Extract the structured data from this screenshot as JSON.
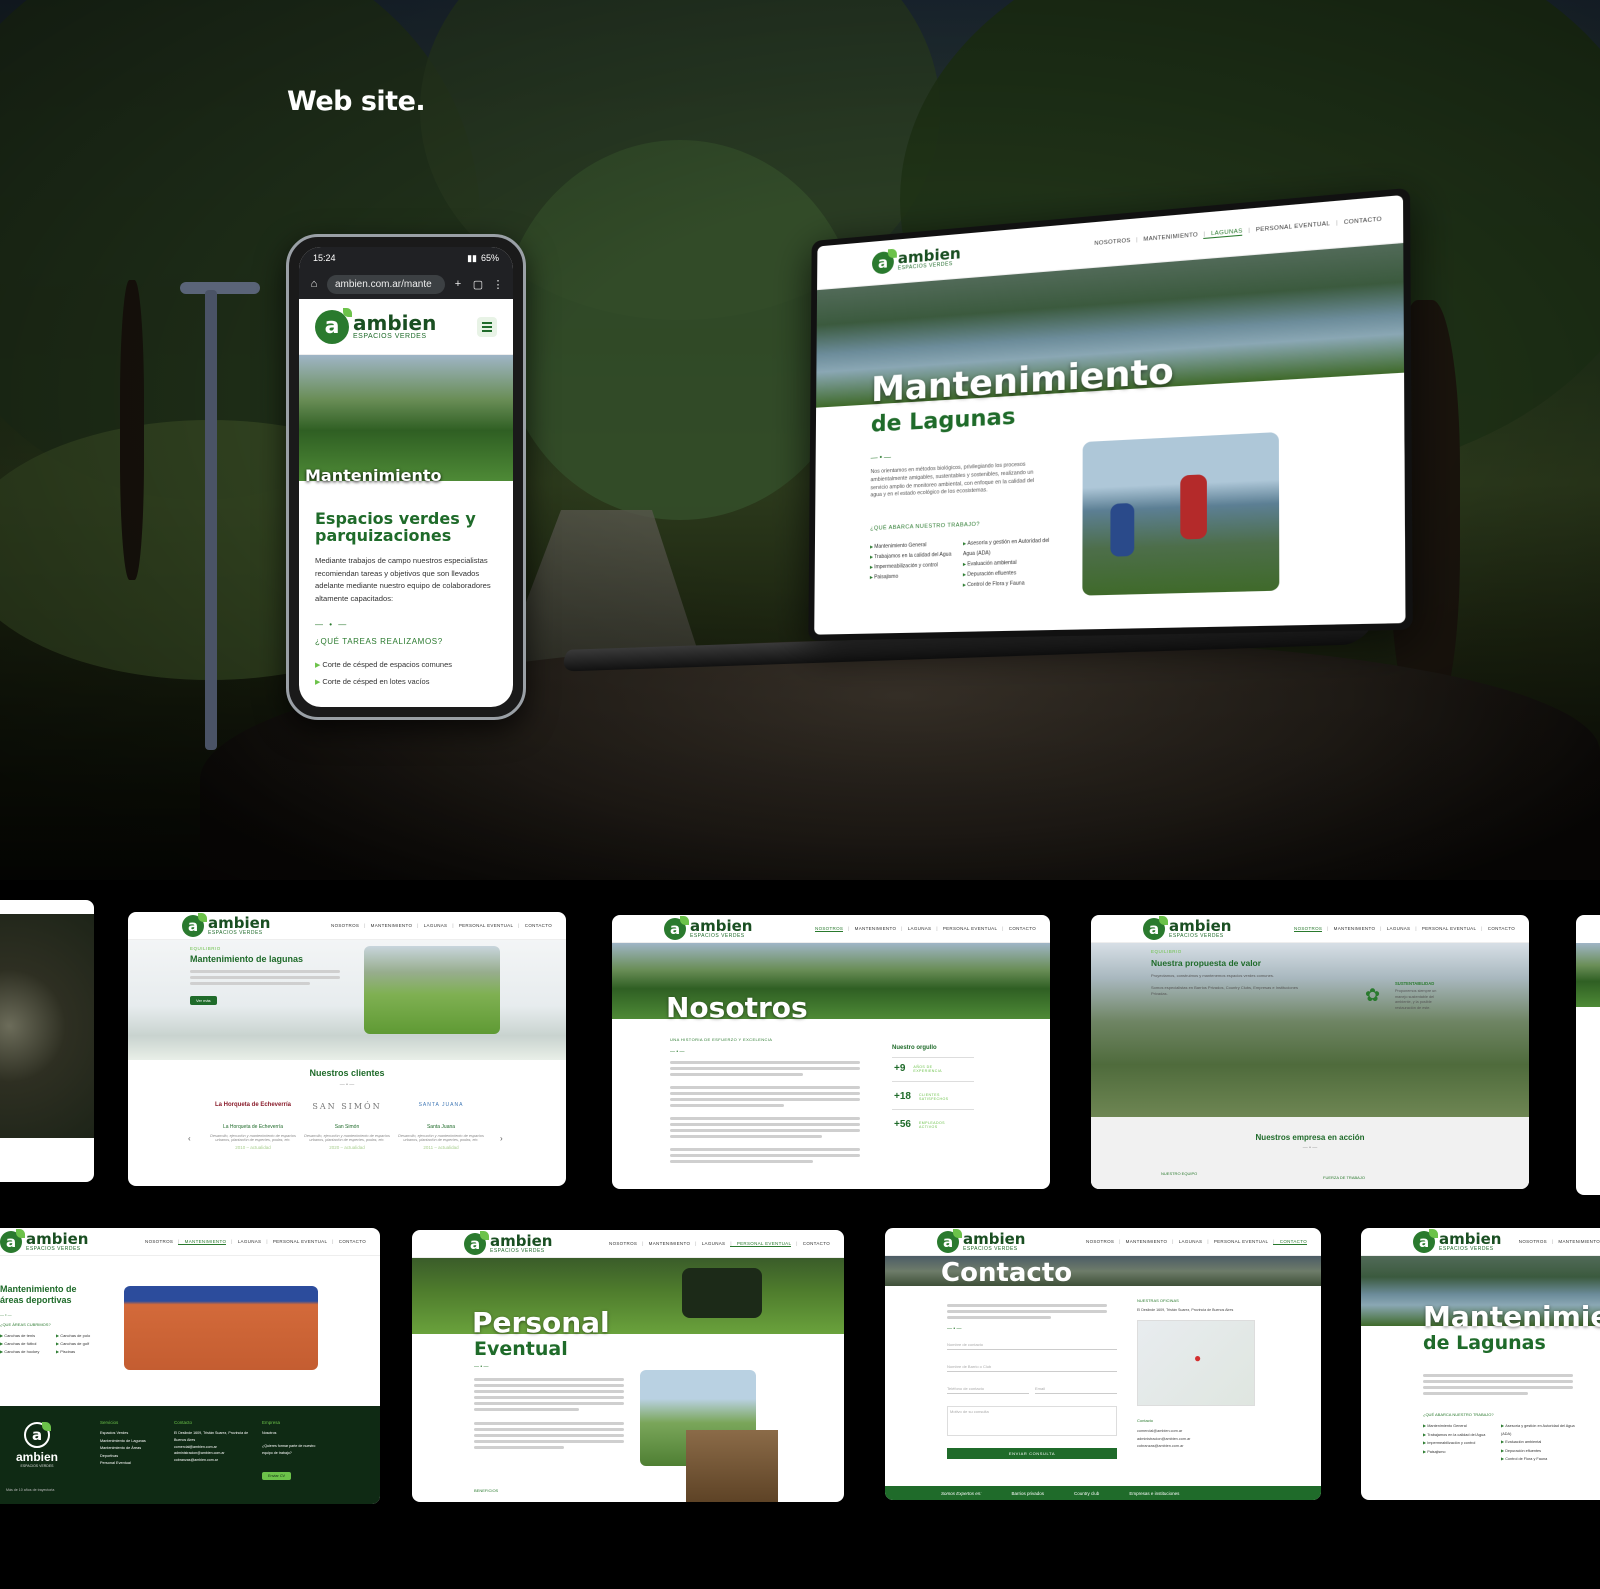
{
  "section_title": "Web site.",
  "brand": {
    "name": "ambien",
    "tagline": "ESPACIOS VERDES",
    "accent": "#1f6b2a",
    "light_accent": "#6cc24a"
  },
  "nav": [
    "NOSOTROS",
    "MANTENIMIENTO",
    "LAGUNAS",
    "PERSONAL EVENTUAL",
    "CONTACTO"
  ],
  "phone": {
    "time": "15:24",
    "battery": "65%",
    "url": "ambien.com.ar/mante",
    "hero_title": "Mantenimiento",
    "heading": "Espacios verdes y parquizaciones",
    "body": "Mediante trabajos de campo nuestros especialistas recomiendan tareas y objetivos que son llevados adelante mediante nuestro equipo de colaboradores altamente capacitados:",
    "dash": "— • —",
    "question": "¿QUÉ TAREAS REALIZAMOS?",
    "items": [
      "Corte de césped de espacios comunes",
      "Corte de césped en lotes vacíos"
    ]
  },
  "laptop": {
    "title_line1": "Mantenimiento",
    "title_line2": "de Lagunas",
    "dash": "— • —",
    "body": "Nos orientamos en métodos biológicos, privilegiando los procesos ambientalmente amigables, sustentables y sostenibles, realizando un servicio amplio de monitoreo ambiental, con enfoque en la calidad del agua y en el estado ecológico de los ecosistemas.",
    "question": "¿QUÉ ABARCA NUESTRO TRABAJO?",
    "list_left": [
      "Mantenimiento General",
      "Trabajamos en la calidad del Agua",
      "Impermeabilización y control",
      "Paisajismo"
    ],
    "list_right": [
      "Asesoría y gestión en Autoridad del Agua (ADA)",
      "Evaluación ambiental",
      "Depuración efluentes",
      "Control de Flora y Fauna"
    ]
  },
  "cards": {
    "lagunas_clientes": {
      "kicker": "EQUILIBRIO",
      "title": "Mantenimiento de lagunas",
      "button": "Ver más",
      "clients_title": "Nuestros clientes",
      "clients": [
        {
          "logo": "La Horqueta de Echeverría",
          "name": "La Horqueta de Echeverría",
          "years": "2010 – actualidad"
        },
        {
          "logo": "SAN SIMÓN",
          "name": "San Simón",
          "years": "2020 – actualidad"
        },
        {
          "logo": "SANTA JUANA",
          "name": "Santa Juana",
          "years": "2011 – actualidad"
        }
      ],
      "client_desc": "Desarrollo, ejecución y mantenimiento de espacios urbanos, plantación de especies, podas, etc."
    },
    "nosotros": {
      "hero": "Nosotros",
      "kicker": "UNA HISTORIA DE ESFUERZO Y EXCELENCIA",
      "pride": "Nuestro orgullo",
      "stats": [
        {
          "value": "+9",
          "label": "AÑOS DE EXPERIENCIA"
        },
        {
          "value": "+18",
          "label": "CLIENTES SATISFECHOS"
        },
        {
          "value": "+56",
          "label": "EMPLEADOS ACTIVOS"
        }
      ]
    },
    "propuesta": {
      "kicker": "EQUILIBRIO",
      "title": "Nuestra propuesta de valor",
      "p1": "Proyectamos, construimos y mantenemos espacios verdes comunes.",
      "p2": "Somos especialistas en Barrios Privados, Country Clubs, Empresas e Instituciones Privadas.",
      "side_title": "SUSTENTABILIDAD",
      "side_text": "Proponemos siempre un manejo sustentable del ambiente, y la posible restauración de este.",
      "action": "Nuestros empresa en acción",
      "team": "NUESTRO EQUIPO",
      "workforce": "FUERZA DE TRABAJO"
    },
    "deportivas": {
      "title": "Mantenimiento de áreas deportivas",
      "question": "¿QUE ÁREAS CUBRIMOS?",
      "list_left": [
        "Canchas de tenis",
        "Canchas de fútbol",
        "Canchas de hockey"
      ],
      "list_right": [
        "Canchas de polo",
        "Canchas de golf",
        "Piscinas"
      ],
      "footer": {
        "tagline": "Más de 10 años de trayectoria",
        "services_title": "Servicios",
        "services": [
          "Espacios Verdes",
          "Mantenimiento de Lagunas",
          "Mantenimiento de Áreas Deportivas",
          "Personal Eventual"
        ],
        "contact_title": "Contacto",
        "contact": [
          "El Deslinde 1609, Tristán Suarez, Provincia de Buenos Aires",
          "comercial@ambien.com.ar",
          "administracion@ambien.com.ar",
          "cobranzas@ambien.com.ar"
        ],
        "company_title": "Empresa",
        "company": [
          "Nosotros",
          "¿Quieres formar parte de nuestro equipo de trabajo?"
        ],
        "cv_button": "Enviar CV"
      }
    },
    "personal": {
      "title_line1": "Personal",
      "title_line2": "Eventual",
      "benefits": "BENEFICIOS"
    },
    "contacto": {
      "hero": "Contacto",
      "offices": "NUESTRAS OFICINAS",
      "address": "El Deslinde 1609, Tristán Suarez, Provincia de Buenos Aires",
      "fields": [
        "Nombre de contacto",
        "Nombre de Barrio o Club",
        "Teléfono de contacto",
        "Email",
        "Motivo de su consulta"
      ],
      "submit": "ENVIAR CONSULTA",
      "contact_title": "Contacto",
      "emails": [
        "comercial@ambien.com.ar",
        "administracion@ambien.com.ar",
        "cobranzas@ambien.com.ar"
      ],
      "strip_label": "Somos Expertos en:",
      "strip_items": [
        "Barrios privados",
        "Country club",
        "Empresas e instituciones"
      ]
    },
    "lagunas_cut": {
      "title_line1": "Mantenimie",
      "title_line2": "de Lagunas",
      "question": "¿QUÉ ABARCA NUESTRO TRABAJO?",
      "list_left": [
        "Mantenimiento General",
        "Trabajamos en la calidad del Agua",
        "Impermeabilización y control",
        "Paisajismo"
      ],
      "list_right": [
        "Asesoría y gestión en Autoridad del Agua (ADA)",
        "Evaluación ambiental",
        "Depuración efluentes",
        "Control de Flora y Fauna"
      ]
    }
  }
}
